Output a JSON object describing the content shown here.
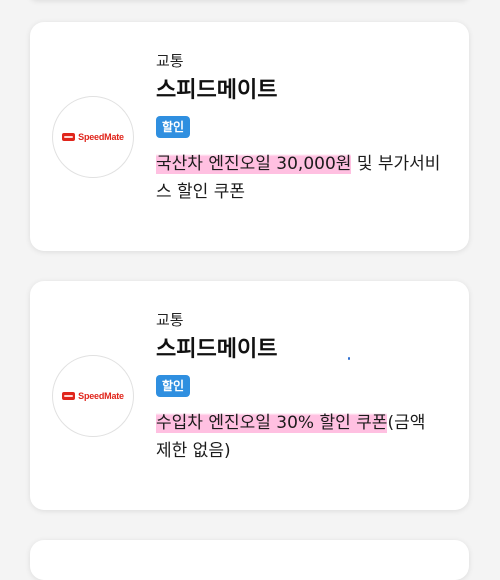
{
  "coupons": [
    {
      "category": "교통",
      "brand": "스피드메이트",
      "badge": "할인",
      "logo_text": "SpeedMate",
      "desc_highlight": "국산차 엔진오일 30,000원",
      "desc_rest": " 및 부가서비스 할인 쿠폰"
    },
    {
      "category": "교통",
      "brand": "스피드메이트",
      "badge": "할인",
      "logo_text": "SpeedMate",
      "desc_highlight": "수입차 엔진오일 30% 할인 쿠폰",
      "desc_rest": "(금액 제한 없음)"
    }
  ],
  "colors": {
    "badge": "#2f8fe0",
    "highlight": "#ffb0d8",
    "logo": "#e0251b"
  }
}
